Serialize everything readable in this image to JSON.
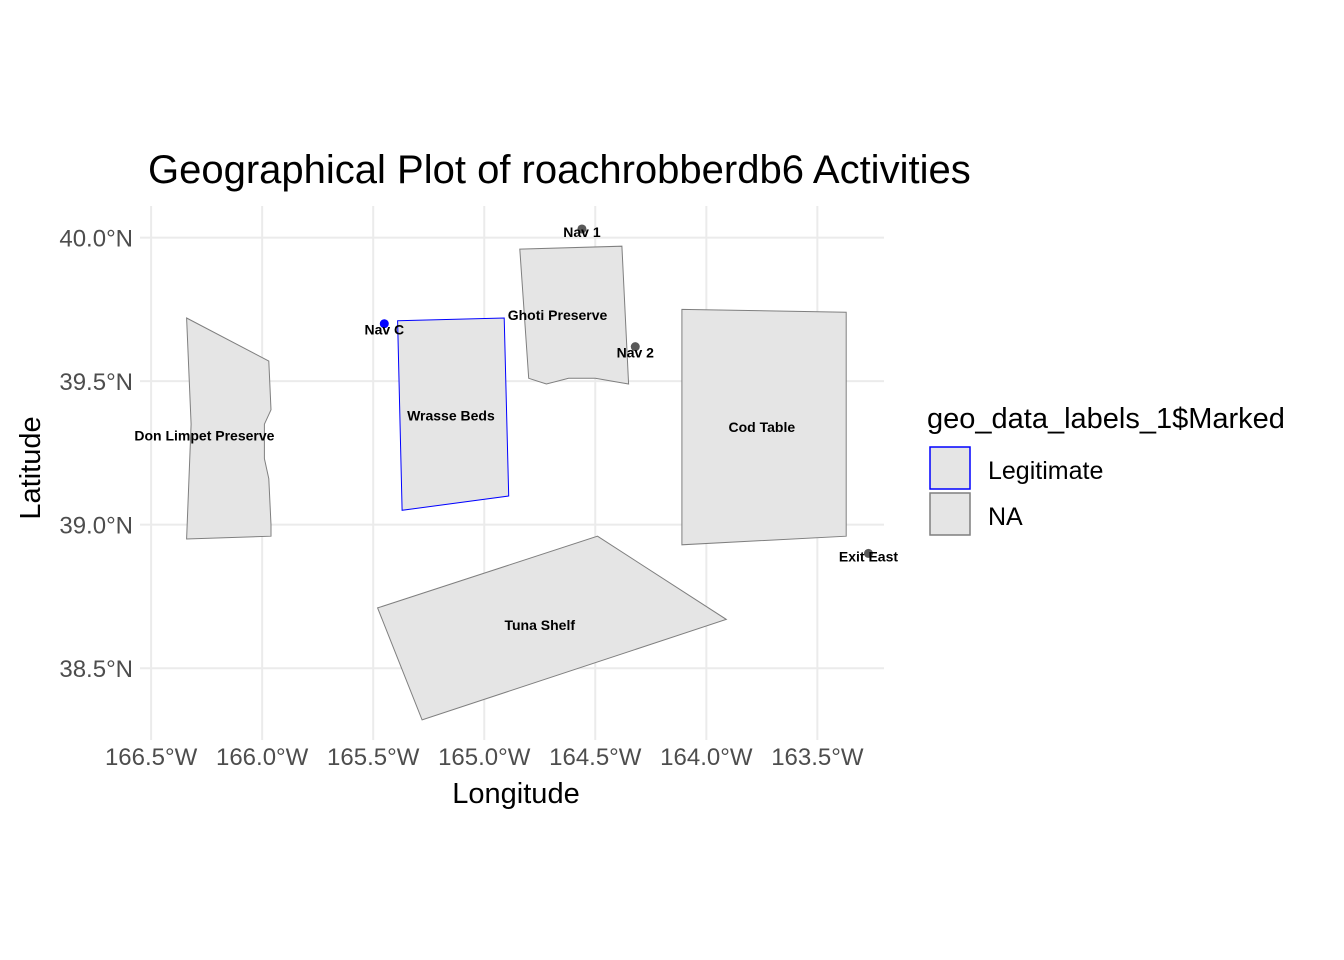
{
  "title": "Geographical Plot of roachrobberdb6 Activities",
  "xlabel": "Longitude",
  "ylabel": "Latitude",
  "legend": {
    "title": "geo_data_labels_1$Marked",
    "items": [
      {
        "label": "Legitimate",
        "border": "#0000ff",
        "fill": "#e5e5e5"
      },
      {
        "label": "NA",
        "border": "#7f7f7f",
        "fill": "#e5e5e5"
      }
    ]
  },
  "chart_data": {
    "type": "map",
    "xlim": [
      -166.55,
      -163.2
    ],
    "ylim": [
      38.25,
      40.11
    ],
    "x_ticks": [
      {
        "value": -166.5,
        "label": "166.5°W"
      },
      {
        "value": -166.0,
        "label": "166.0°W"
      },
      {
        "value": -165.5,
        "label": "165.5°W"
      },
      {
        "value": -165.0,
        "label": "165.0°W"
      },
      {
        "value": -164.5,
        "label": "164.5°W"
      },
      {
        "value": -164.0,
        "label": "164.0°W"
      },
      {
        "value": -163.5,
        "label": "163.5°W"
      }
    ],
    "y_ticks": [
      {
        "value": 38.5,
        "label": "38.5°N"
      },
      {
        "value": 39.0,
        "label": "39.0°N"
      },
      {
        "value": 39.5,
        "label": "39.5°N"
      },
      {
        "value": 40.0,
        "label": "40.0°N"
      }
    ],
    "polygons": [
      {
        "name": "Don Limpet Preserve",
        "marked": "NA",
        "label_at": [
          -166.26,
          39.31
        ],
        "coords": [
          [
            -166.34,
            39.72
          ],
          [
            -165.97,
            39.57
          ],
          [
            -165.96,
            39.4
          ],
          [
            -165.99,
            39.35
          ],
          [
            -165.99,
            39.23
          ],
          [
            -165.97,
            39.16
          ],
          [
            -165.96,
            39.0
          ],
          [
            -165.96,
            38.96
          ],
          [
            -166.34,
            38.95
          ],
          [
            -166.32,
            39.35
          ]
        ]
      },
      {
        "name": "Wrasse Beds",
        "marked": "Legitimate",
        "label_at": [
          -165.15,
          39.38
        ],
        "coords": [
          [
            -165.39,
            39.71
          ],
          [
            -164.91,
            39.72
          ],
          [
            -164.89,
            39.1
          ],
          [
            -165.37,
            39.05
          ]
        ]
      },
      {
        "name": "Ghoti Preserve",
        "marked": "NA",
        "label_at": [
          -164.67,
          39.73
        ],
        "coords": [
          [
            -164.84,
            39.96
          ],
          [
            -164.38,
            39.97
          ],
          [
            -164.35,
            39.49
          ],
          [
            -164.5,
            39.51
          ],
          [
            -164.62,
            39.51
          ],
          [
            -164.72,
            39.49
          ],
          [
            -164.8,
            39.51
          ]
        ]
      },
      {
        "name": "Cod Table",
        "marked": "NA",
        "label_at": [
          -163.75,
          39.34
        ],
        "coords": [
          [
            -164.11,
            39.75
          ],
          [
            -163.37,
            39.74
          ],
          [
            -163.37,
            38.96
          ],
          [
            -164.11,
            38.93
          ]
        ]
      },
      {
        "name": "Tuna Shelf",
        "marked": "NA",
        "label_at": [
          -164.75,
          38.65
        ],
        "coords": [
          [
            -165.48,
            38.71
          ],
          [
            -164.49,
            38.96
          ],
          [
            -163.91,
            38.67
          ],
          [
            -165.28,
            38.32
          ]
        ]
      }
    ],
    "points": [
      {
        "name": "Nav 1",
        "lon": -164.56,
        "lat": 40.03,
        "marked": "NA",
        "label_at": [
          -164.56,
          40.02
        ]
      },
      {
        "name": "Nav C",
        "lon": -165.45,
        "lat": 39.7,
        "marked": "Legitimate",
        "label_at": [
          -165.45,
          39.68
        ]
      },
      {
        "name": "Nav 2",
        "lon": -164.32,
        "lat": 39.62,
        "marked": "NA",
        "label_at": [
          -164.32,
          39.6
        ]
      },
      {
        "name": "Exit East",
        "lon": -163.27,
        "lat": 38.9,
        "marked": "NA",
        "label_at": [
          -163.27,
          38.89
        ]
      }
    ],
    "colors": {
      "legitimate": "#0000ff",
      "na": "#7f7f7f",
      "na_point": "#595959",
      "fill": "#e5e5e5",
      "grid": "#ebebeb"
    }
  }
}
